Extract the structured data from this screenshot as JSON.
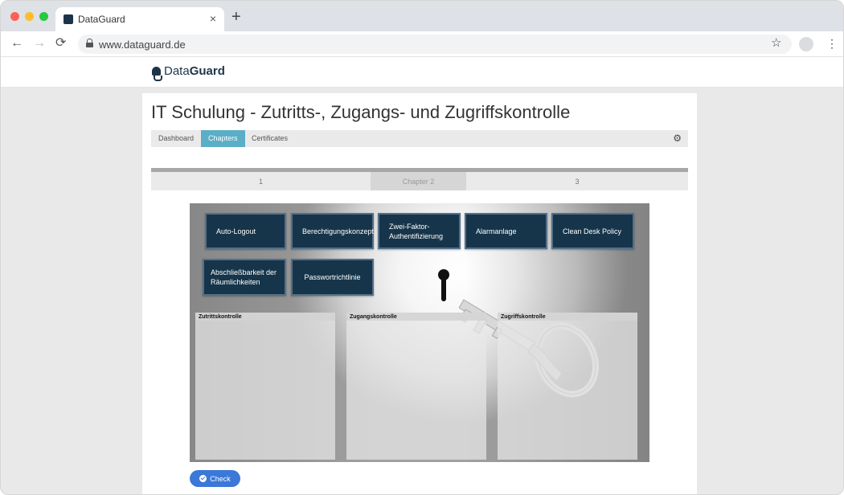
{
  "browser": {
    "tab_title": "DataGuard",
    "tab_close": "×",
    "new_tab": "+",
    "url": "www.dataguard.de",
    "back": "←",
    "forward": "→",
    "reload": "⟳",
    "star": "☆",
    "menu": "⋮",
    "icons": [
      "lock-icon",
      "star-icon",
      "profile-avatar",
      "menu-icon"
    ]
  },
  "site": {
    "logo_regular": "Data",
    "logo_bold": "Guard"
  },
  "page": {
    "title": "IT Schulung - Zutritts-, Zugangs- und Zugriffskontrolle",
    "subnav": [
      {
        "label": "Dashboard",
        "active": false
      },
      {
        "label": "Chapters",
        "active": true
      },
      {
        "label": "Certificates",
        "active": false
      }
    ],
    "settings_icon": "⚙",
    "steps": [
      {
        "label": "1",
        "active": false
      },
      {
        "label": "Chapter 2",
        "active": true
      },
      {
        "label": "3",
        "active": false
      }
    ]
  },
  "exercise": {
    "tiles": [
      {
        "label": "Auto-Logout"
      },
      {
        "label": "Berechtigungskonzept"
      },
      {
        "label": "Zwei-Faktor-Authentifizierung"
      },
      {
        "label": "Alarmanlage"
      },
      {
        "label": "Clean Desk Policy"
      },
      {
        "label": "Abschließbarkeit der Räumlichkeiten"
      },
      {
        "label": "Passwortrichtlinie"
      }
    ],
    "zones": [
      {
        "label": "Zutrittskontrolle"
      },
      {
        "label": "Zugangskontrolle"
      },
      {
        "label": "Zugriffskontrolle"
      }
    ],
    "check_button": "Check"
  },
  "colors": {
    "accent_tab": "#5aaec6",
    "tile_bg": "#16354a",
    "check_button": "#3b78d8",
    "brand": "#1d3448"
  }
}
